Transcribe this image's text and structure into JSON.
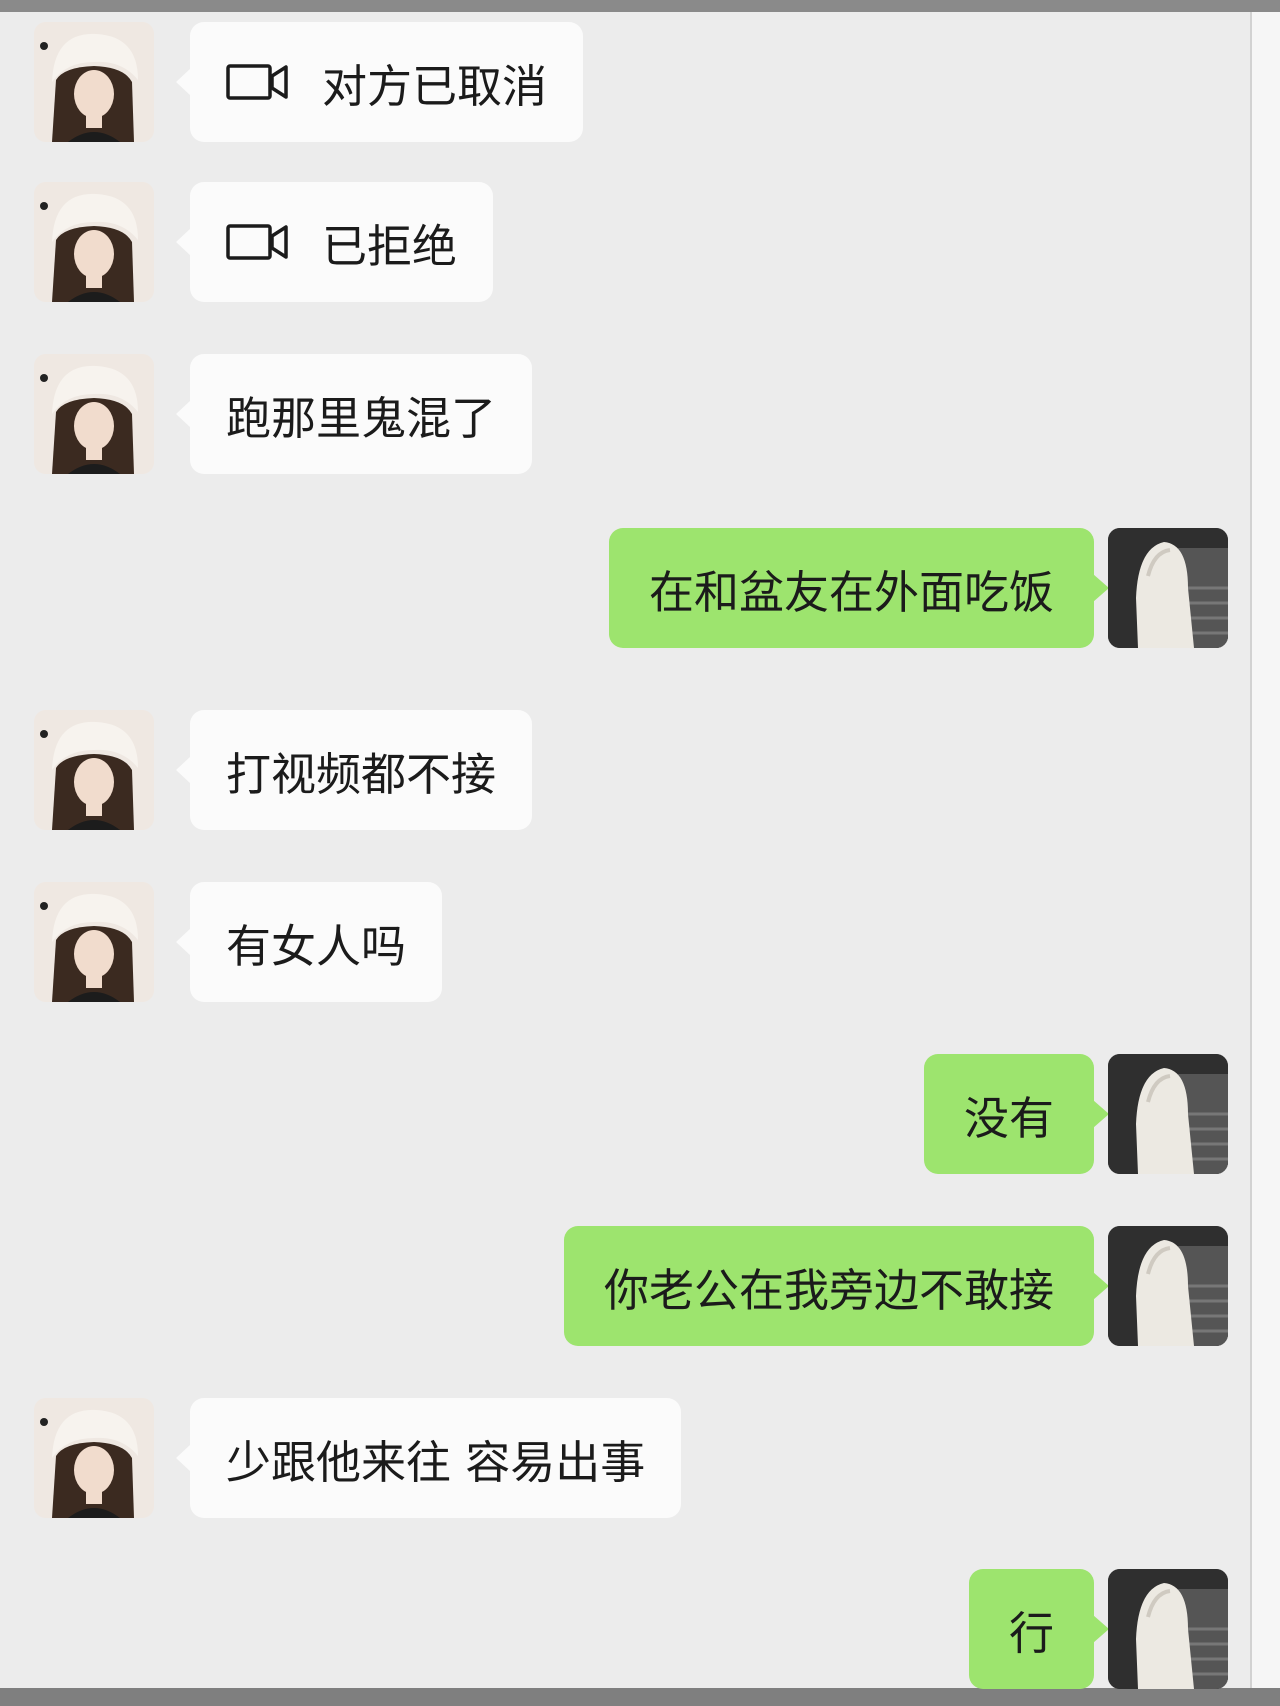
{
  "messages": [
    {
      "side": "in",
      "kind": "call",
      "icon": "video-call-icon",
      "text": "对方已取消"
    },
    {
      "side": "in",
      "kind": "call",
      "icon": "video-call-icon",
      "text": "已拒绝"
    },
    {
      "side": "in",
      "kind": "text",
      "text": "跑那里鬼混了"
    },
    {
      "side": "out",
      "kind": "text",
      "text": "在和盆友在外面吃饭"
    },
    {
      "side": "in",
      "kind": "text",
      "text": "打视频都不接"
    },
    {
      "side": "in",
      "kind": "text",
      "text": "有女人吗"
    },
    {
      "side": "out",
      "kind": "text",
      "text": "没有"
    },
    {
      "side": "out",
      "kind": "text",
      "text": "你老公在我旁边不敢接"
    },
    {
      "side": "in",
      "kind": "text",
      "text": "少跟他来往 容易出事"
    },
    {
      "side": "out",
      "kind": "text",
      "text": "行"
    }
  ],
  "colors": {
    "background": "#ececec",
    "incoming_bubble": "#fbfbfb",
    "outgoing_bubble": "#9de46e",
    "text": "#1b1b1b"
  }
}
